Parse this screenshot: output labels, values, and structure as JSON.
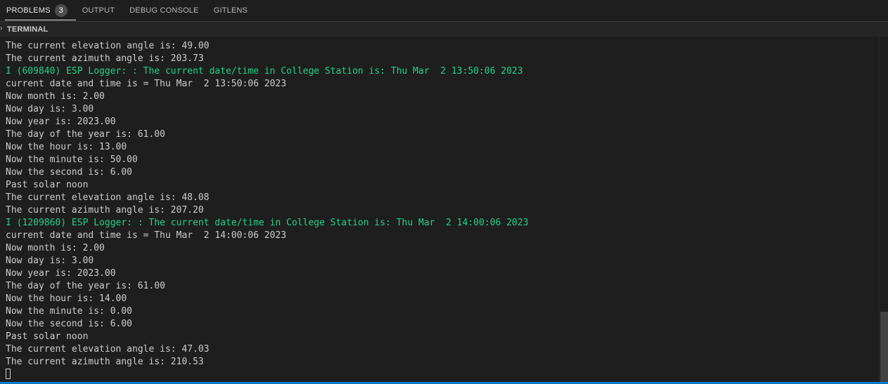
{
  "tabs": [
    {
      "label": "PROBLEMS",
      "badge": "3",
      "active": true
    },
    {
      "label": "OUTPUT"
    },
    {
      "label": "DEBUG CONSOLE"
    },
    {
      "label": "GITLENS"
    }
  ],
  "section": {
    "chevron": "›",
    "title": "TERMINAL"
  },
  "terminal_lines": [
    {
      "text": "The current elevation angle is: 49.00"
    },
    {
      "text": "The current azimuth angle is: 203.73"
    },
    {
      "text": "I (609840) ESP Logger: : The current date/time in College Station is: Thu Mar  2 13:50:06 2023",
      "color": "green"
    },
    {
      "text": "current date and time is = Thu Mar  2 13:50:06 2023"
    },
    {
      "text": "Now month is: 2.00"
    },
    {
      "text": "Now day is: 3.00"
    },
    {
      "text": "Now year is: 2023.00"
    },
    {
      "text": "The day of the year is: 61.00"
    },
    {
      "text": "Now the hour is: 13.00"
    },
    {
      "text": "Now the minute is: 50.00"
    },
    {
      "text": "Now the second is: 6.00"
    },
    {
      "text": "Past solar noon"
    },
    {
      "text": "The current elevation angle is: 48.08"
    },
    {
      "text": "The current azimuth angle is: 207.20"
    },
    {
      "text": "I (1209860) ESP Logger: : The current date/time in College Station is: Thu Mar  2 14:00:06 2023",
      "color": "green"
    },
    {
      "text": "current date and time is = Thu Mar  2 14:00:06 2023"
    },
    {
      "text": "Now month is: 2.00"
    },
    {
      "text": "Now day is: 3.00"
    },
    {
      "text": "Now year is: 2023.00"
    },
    {
      "text": "The day of the year is: 61.00"
    },
    {
      "text": "Now the hour is: 14.00"
    },
    {
      "text": "Now the minute is: 0.00"
    },
    {
      "text": "Now the second is: 6.00"
    },
    {
      "text": "Past solar noon"
    },
    {
      "text": "The current elevation angle is: 47.03"
    },
    {
      "text": "The current azimuth angle is: 210.53"
    }
  ],
  "colors": {
    "background": "#1e1e1e",
    "text": "#cccccc",
    "log_green": "#23d18b",
    "accent": "#007acc"
  }
}
